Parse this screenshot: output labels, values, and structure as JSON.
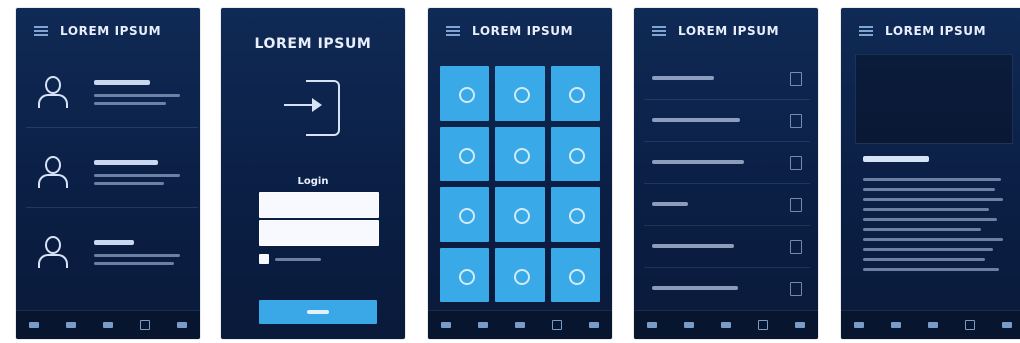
{
  "screens": [
    {
      "title": "LOREM IPSUM"
    },
    {
      "title": "LOREM IPSUM",
      "login_label": "Login"
    },
    {
      "title": "LOREM IPSUM"
    },
    {
      "title": "LOREM IPSUM"
    },
    {
      "title": "LOREM IPSUM"
    }
  ],
  "colors": {
    "accent": "#39a9e8",
    "background": "#0b1f45"
  }
}
